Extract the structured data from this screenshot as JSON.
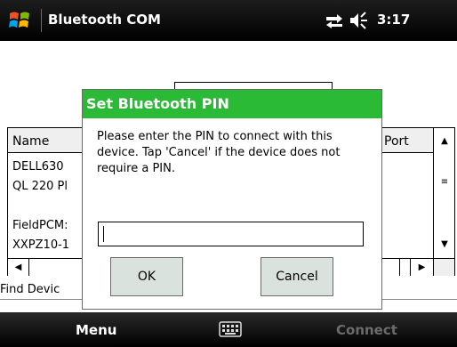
{
  "titlebar": {
    "title": "Bluetooth COM",
    "time": "3:17",
    "icons": [
      "windows-start-icon",
      "connectivity-icon",
      "volume-icon"
    ]
  },
  "list": {
    "columns": [
      "Name",
      "Port"
    ],
    "rows": [
      "DELL630",
      "QL 220 Pl",
      "",
      "FieldPCM:",
      "XXPZ10-1"
    ]
  },
  "find_devices_label": "Find Devic",
  "dialog": {
    "title": "Set Bluetooth PIN",
    "message": "Please enter the PIN to connect with this device. Tap 'Cancel' if the device does not require a PIN.",
    "pin_value": "",
    "ok_label": "OK",
    "cancel_label": "Cancel"
  },
  "softkeys": {
    "left": "Menu",
    "right": "Connect",
    "keyboard_icon": "keyboard-icon"
  },
  "colors": {
    "dialog_title": "#2bba36",
    "button_face": "#d9e2dc",
    "softkey_disabled": "#6b6b6b"
  }
}
